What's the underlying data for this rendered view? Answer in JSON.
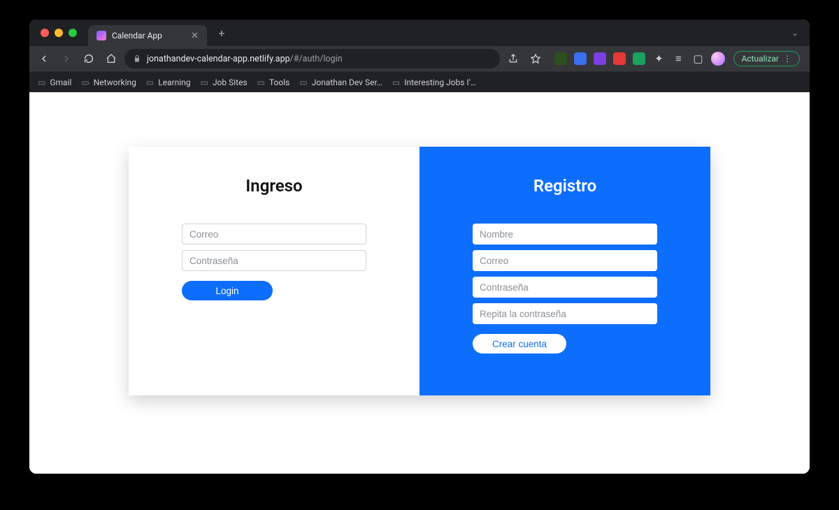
{
  "browser": {
    "tab_title": "Calendar App",
    "url_host": "jonathandev-calendar-app.netlify.app",
    "url_path": "/#/auth/login",
    "update_label": "Actualizar"
  },
  "bookmarks": [
    "Gmail",
    "Networking",
    "Learning",
    "Job Sites",
    "Tools",
    "Jonathan Dev Ser…",
    "Interesting Jobs I'…"
  ],
  "colors": {
    "primary": "#0d6efd"
  },
  "login": {
    "heading": "Ingreso",
    "email_placeholder": "Correo",
    "password_placeholder": "Contraseña",
    "submit_label": "Login"
  },
  "register": {
    "heading": "Registro",
    "name_placeholder": "Nombre",
    "email_placeholder": "Correo",
    "password_placeholder": "Contraseña",
    "password2_placeholder": "Repita la contraseña",
    "submit_label": "Crear cuenta"
  }
}
